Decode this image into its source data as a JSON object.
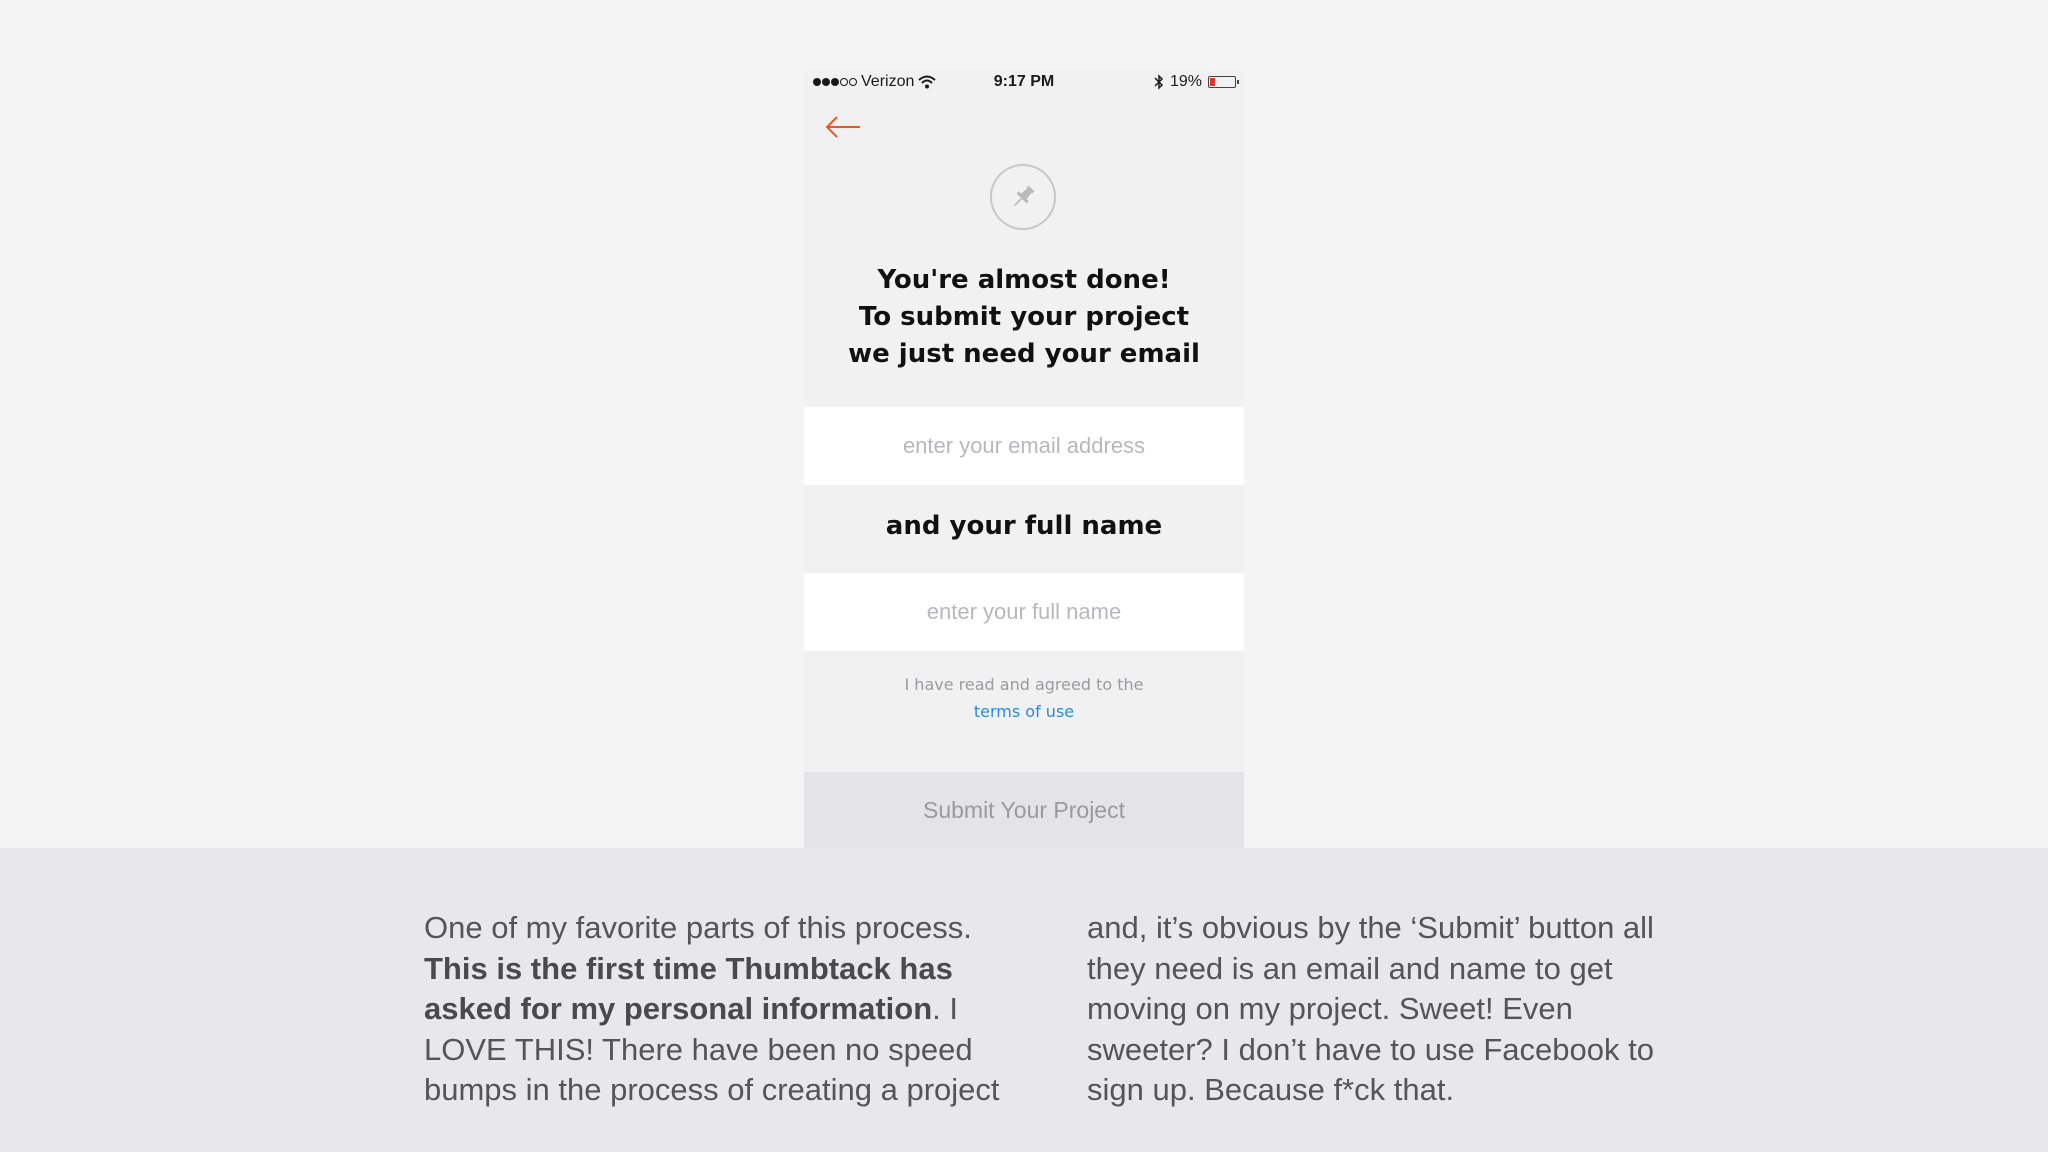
{
  "status_bar": {
    "carrier": "Verizon",
    "time": "9:17 PM",
    "battery_percent": "19%",
    "battery_level": 0.19,
    "icons": [
      "signal-dots-icon",
      "wifi-icon",
      "bluetooth-icon",
      "battery-icon"
    ]
  },
  "nav": {
    "back_icon": "arrow-left-icon",
    "accent_color": "#e8562a"
  },
  "hero_icon": "pushpin-icon",
  "heading": {
    "line1": "You're almost done!",
    "line2": "To submit your project",
    "line3": "we just need your email"
  },
  "email_field": {
    "placeholder": "enter your email address",
    "value": ""
  },
  "name_heading": "and your full name",
  "name_field": {
    "placeholder": "enter your full name",
    "value": ""
  },
  "terms": {
    "text": "I have read and agreed to the",
    "link": "terms of use",
    "link_color": "#2e8ad8"
  },
  "submit_button": {
    "label": "Submit Your Project"
  },
  "caption": {
    "left": {
      "p1": "One of my favorite parts of this process.",
      "bold": "This is the first time Thumbtack has asked for my personal information",
      "p2": ". I LOVE THIS! There have been no speed bumps in the process of creating a project"
    },
    "right": "and, it’s obvious by the ‘Submit’ button all they need is an email and name to get moving on my project. Sweet! Even sweeter? I don’t have to use Facebook to sign up. Because f*ck that."
  }
}
